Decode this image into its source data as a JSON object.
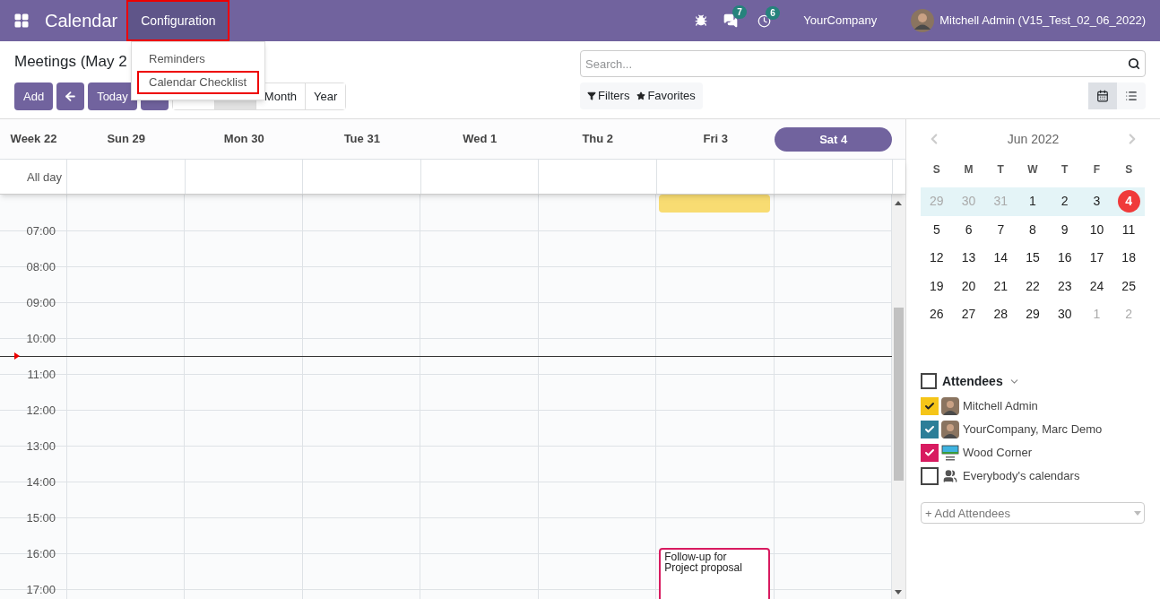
{
  "navbar": {
    "app_title": "Calendar",
    "menus": [
      {
        "label": "Configuration",
        "open": true,
        "highlighted": true
      }
    ],
    "chat_badge": "7",
    "activity_badge": "6",
    "company": "YourCompany",
    "user": "Mitchell Admin (V15_Test_02_06_2022)"
  },
  "dropdown": {
    "items": [
      {
        "label": "Reminders",
        "highlighted": false
      },
      {
        "label": "Calendar Checklist",
        "highlighted": true
      }
    ]
  },
  "control_panel": {
    "title": "Meetings (May 2",
    "add_button": "Add",
    "today_button": "Today",
    "view_buttons": [
      {
        "selected": false
      },
      {
        "selected": true
      },
      {
        "label": "Month",
        "selected": false
      },
      {
        "label": "Year",
        "selected": false
      }
    ],
    "search": {
      "placeholder": "Search..."
    },
    "filters": "Filters",
    "favorites": "Favorites",
    "view_switch": [
      {
        "kind": "calendar",
        "selected": true
      },
      {
        "kind": "list",
        "selected": false
      }
    ]
  },
  "week_grid": {
    "week_label": "Week 22",
    "all_day": "All day",
    "days": [
      {
        "label": "Sun 29",
        "selected": false
      },
      {
        "label": "Mon 30",
        "selected": false
      },
      {
        "label": "Tue 31",
        "selected": false
      },
      {
        "label": "Wed 1",
        "selected": false
      },
      {
        "label": "Thu 2",
        "selected": false
      },
      {
        "label": "Fri 3",
        "selected": false,
        "events": [
          {
            "kind": "top",
            "color": "#f8dc72"
          },
          {
            "kind": "bottom",
            "title": "Follow-up for Project proposal",
            "color": "#d81b60"
          }
        ]
      },
      {
        "label": "Sat 4",
        "selected": true
      }
    ],
    "hours": [
      {
        "label": "07:00",
        "now": false
      },
      {
        "label": "08:00",
        "now": false
      },
      {
        "label": "09:00",
        "now": false
      },
      {
        "label": "10:00",
        "now": true
      },
      {
        "label": "11:00",
        "now": false
      },
      {
        "label": "12:00",
        "now": false
      },
      {
        "label": "13:00",
        "now": false
      },
      {
        "label": "14:00",
        "now": false
      },
      {
        "label": "15:00",
        "now": false
      },
      {
        "label": "16:00",
        "now": false
      },
      {
        "label": "17:00"
      }
    ]
  },
  "mini_calendar": {
    "month": "Jun 2022",
    "weekdays": [
      "S",
      "M",
      "T",
      "W",
      "T",
      "F",
      "S"
    ],
    "weeks": [
      {
        "selected": true,
        "days": [
          {
            "label": "29",
            "muted": true,
            "today": false
          },
          {
            "label": "30",
            "muted": true,
            "today": false
          },
          {
            "label": "31",
            "muted": true,
            "today": false
          },
          {
            "label": "1",
            "muted": false,
            "today": false
          },
          {
            "label": "2",
            "muted": false,
            "today": false
          },
          {
            "label": "3",
            "muted": false,
            "today": false
          },
          {
            "label": "4",
            "muted": false,
            "today": true
          }
        ]
      },
      {
        "selected": false,
        "days": [
          {
            "label": "5",
            "muted": false,
            "today": false
          },
          {
            "label": "6",
            "muted": false,
            "today": false
          },
          {
            "label": "7",
            "muted": false,
            "today": false
          },
          {
            "label": "8",
            "muted": false,
            "today": false
          },
          {
            "label": "9",
            "muted": false,
            "today": false
          },
          {
            "label": "10",
            "muted": false,
            "today": false
          },
          {
            "label": "11",
            "muted": false,
            "today": false
          }
        ]
      },
      {
        "selected": false,
        "days": [
          {
            "label": "12",
            "muted": false,
            "today": false
          },
          {
            "label": "13",
            "muted": false,
            "today": false
          },
          {
            "label": "14",
            "muted": false,
            "today": false
          },
          {
            "label": "15",
            "muted": false,
            "today": false
          },
          {
            "label": "16",
            "muted": false,
            "today": false
          },
          {
            "label": "17",
            "muted": false,
            "today": false
          },
          {
            "label": "18",
            "muted": false,
            "today": false
          }
        ]
      },
      {
        "selected": false,
        "days": [
          {
            "label": "19",
            "muted": false,
            "today": false
          },
          {
            "label": "20",
            "muted": false,
            "today": false
          },
          {
            "label": "21",
            "muted": false,
            "today": false
          },
          {
            "label": "22",
            "muted": false,
            "today": false
          },
          {
            "label": "23",
            "muted": false,
            "today": false
          },
          {
            "label": "24",
            "muted": false,
            "today": false
          },
          {
            "label": "25",
            "muted": false,
            "today": false
          }
        ]
      },
      {
        "selected": false,
        "days": [
          {
            "label": "26",
            "muted": false,
            "today": false
          },
          {
            "label": "27",
            "muted": false,
            "today": false
          },
          {
            "label": "28",
            "muted": false,
            "today": false
          },
          {
            "label": "29",
            "muted": false,
            "today": false
          },
          {
            "label": "30",
            "muted": false,
            "today": false
          },
          {
            "label": "1",
            "muted": true,
            "today": false
          },
          {
            "label": "2",
            "muted": true,
            "today": false
          }
        ]
      }
    ]
  },
  "attendees": {
    "title": "Attendees",
    "checked": false,
    "items": [
      {
        "name": "Mitchell Admin",
        "checked": true,
        "color": "#f5c518",
        "kind": "person"
      },
      {
        "name": "YourCompany, Marc Demo",
        "checked": true,
        "color": "#2c7e98",
        "kind": "person"
      },
      {
        "name": "Wood Corner",
        "checked": true,
        "color": "#d81b60",
        "kind": "logo"
      },
      {
        "name": "Everybody's calendars",
        "checked": false,
        "kind": "group"
      }
    ],
    "add_placeholder": "+ Add Attendees"
  }
}
